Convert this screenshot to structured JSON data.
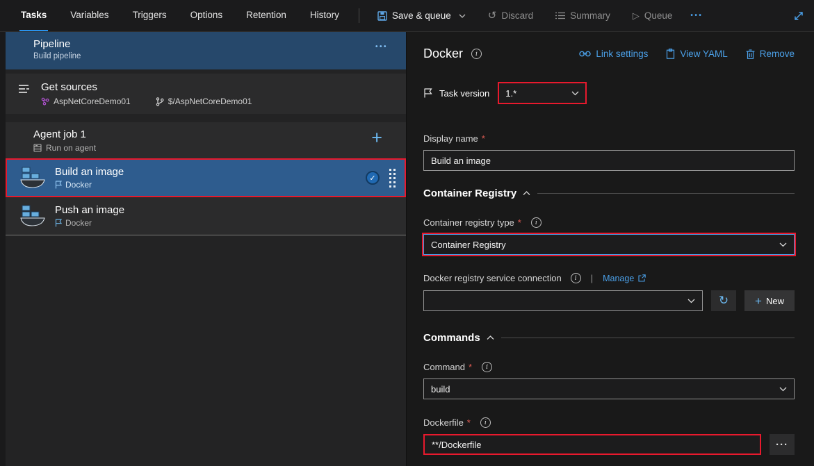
{
  "topbar": {
    "tabs": [
      "Tasks",
      "Variables",
      "Triggers",
      "Options",
      "Retention",
      "History"
    ],
    "save_queue": "Save & queue",
    "discard": "Discard",
    "summary": "Summary",
    "queue": "Queue",
    "ellipsis": "•••"
  },
  "pipeline": {
    "title": "Pipeline",
    "subtitle": "Build pipeline",
    "ellipsis": "•••"
  },
  "sources": {
    "title": "Get sources",
    "repo": "AspNetCoreDemo01",
    "path": "$/AspNetCoreDemo01"
  },
  "agent": {
    "title": "Agent job 1",
    "subtitle": "Run on agent",
    "add": "+"
  },
  "tasks": [
    {
      "title": "Build an image",
      "type": "Docker"
    },
    {
      "title": "Push an image",
      "type": "Docker"
    }
  ],
  "panel": {
    "title": "Docker",
    "link_settings": "Link settings",
    "view_yaml": "View YAML",
    "remove": "Remove",
    "required": "*",
    "task_version_label": "Task version",
    "task_version_value": "1.*",
    "display_name_label": "Display name",
    "display_name_value": "Build an image",
    "section_container_registry": "Container Registry",
    "registry_type_label": "Container registry type",
    "registry_type_value": "Container Registry",
    "service_connection_label": "Docker registry service connection",
    "service_connection_value": "",
    "manage": "Manage",
    "new_label": "New",
    "new_plus": "+",
    "section_commands": "Commands",
    "command_label": "Command",
    "command_value": "build",
    "dockerfile_label": "Dockerfile",
    "dockerfile_value": "**/Dockerfile",
    "more": "···",
    "refresh_glyph": "↻"
  },
  "colors": {
    "accent_blue": "#4ba0e8",
    "highlight_red": "#e8192d",
    "selected_row_blue": "#2e5c8e",
    "pipeline_header_blue": "#26486b",
    "tab_underline": "#2a93ee"
  }
}
